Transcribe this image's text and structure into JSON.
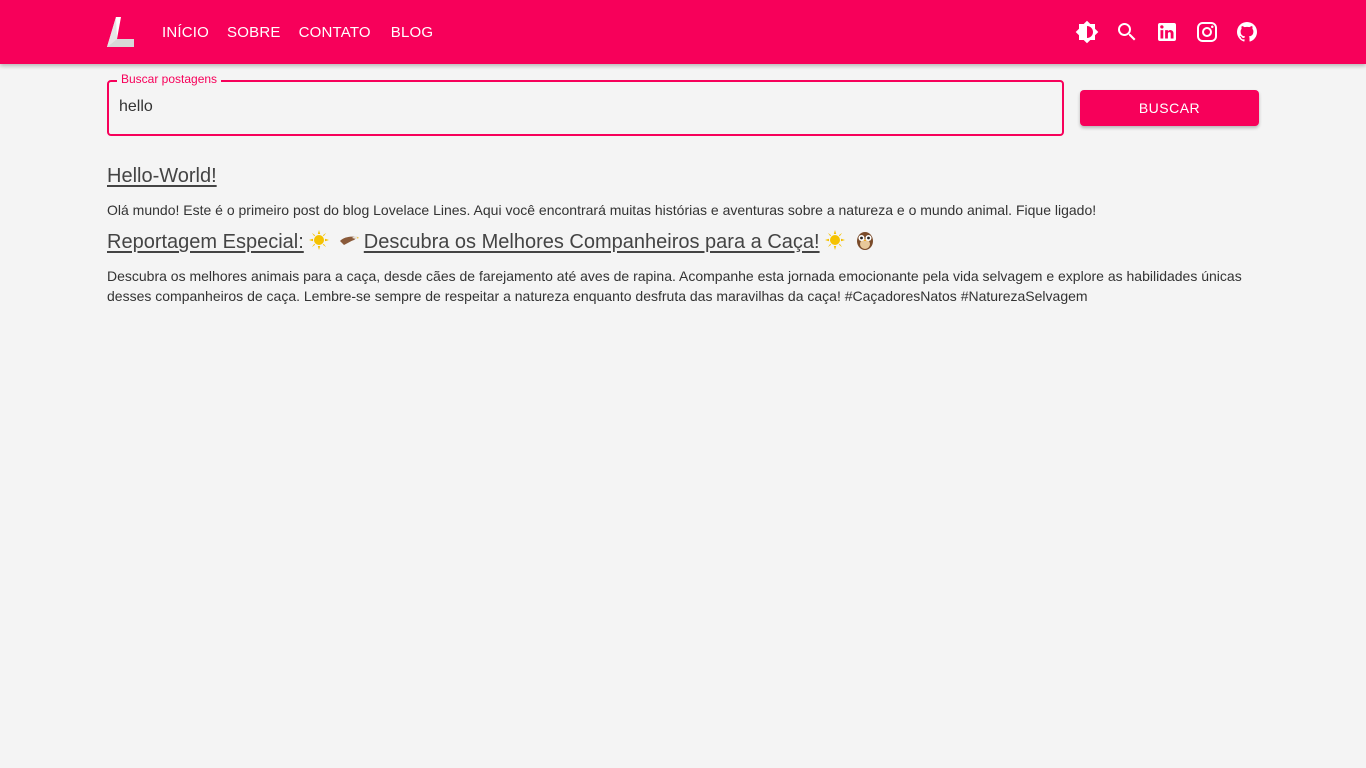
{
  "header": {
    "nav": [
      "INÍCIO",
      "SOBRE",
      "CONTATO",
      "BLOG"
    ],
    "icons": [
      "theme-toggle-icon",
      "search-icon",
      "linkedin-icon",
      "instagram-icon",
      "github-icon"
    ],
    "brand_color": "#f7005a"
  },
  "search": {
    "label": "Buscar postagens",
    "value": "hello",
    "button_label": "BUSCAR"
  },
  "posts": [
    {
      "title": "Hello-World!",
      "description": "Olá mundo! Este é o primeiro post do blog Lovelace Lines. Aqui você encontrará muitas histórias e aventuras sobre a natureza e o mundo animal. Fique ligado!"
    },
    {
      "title_part1": "Reportagem Especial:",
      "title_part2": "Descubra os Melhores Companheiros para a Caça!",
      "title_emojis": [
        "sun-emoji",
        "eagle-emoji",
        "sun-emoji",
        "owl-emoji"
      ],
      "description": "Descubra os melhores animais para a caça, desde cães de farejamento até aves de rapina. Acompanhe esta jornada emocionante pela vida selvagem e explore as habilidades únicas desses companheiros de caça. Lembre-se sempre de respeitar a natureza enquanto desfruta das maravilhas da caça! #CaçadoresNatos #NaturezaSelvagem"
    }
  ]
}
